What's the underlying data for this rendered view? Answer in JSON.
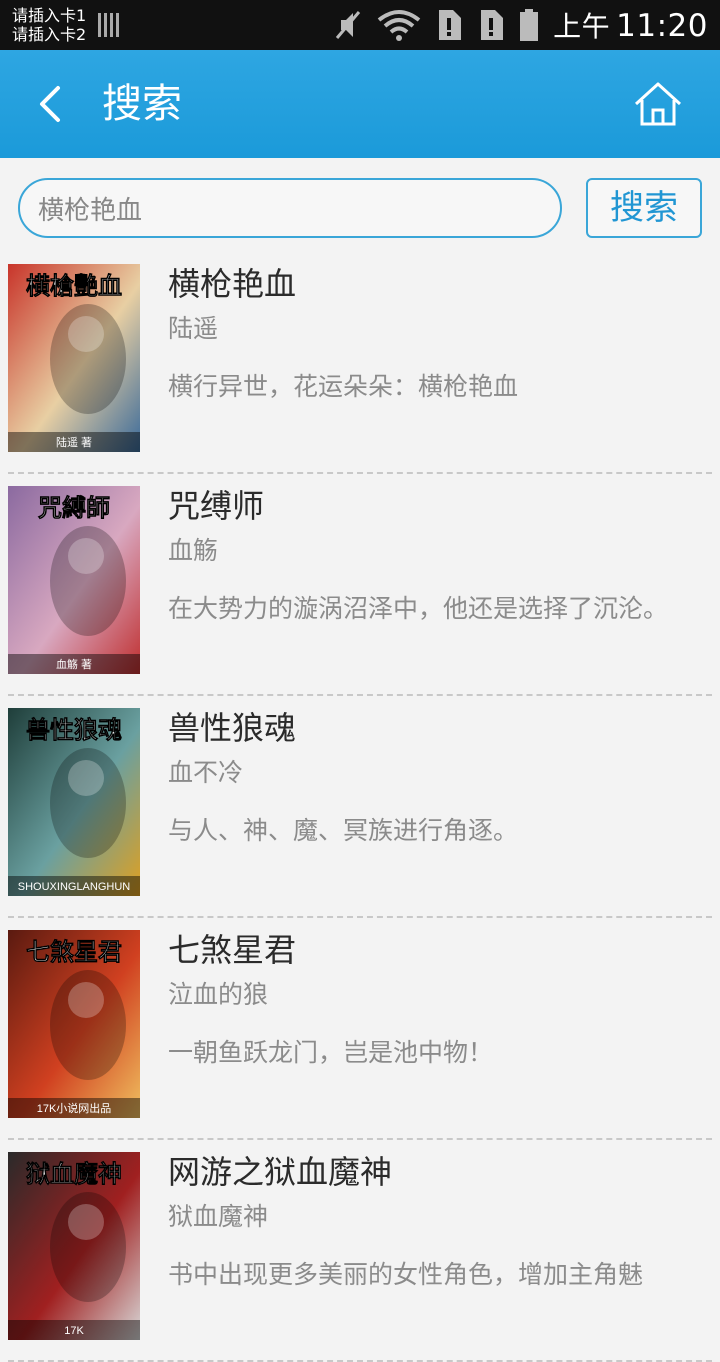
{
  "status_bar": {
    "sim1": "请插入卡1",
    "sim2": "请插入卡2",
    "time_prefix": "上午",
    "time": "11:20"
  },
  "app_bar": {
    "title": "搜索",
    "back_icon": "back-arrow-icon",
    "home_icon": "home-icon"
  },
  "search": {
    "value": "横枪艳血",
    "button_label": "搜索"
  },
  "results": [
    {
      "title": "横枪艳血",
      "author": "陆遥",
      "description": "横行异世，花运朵朵：横枪艳血",
      "cover_text": "横槍艷血",
      "cover_bottom": "陆遥 著",
      "cover_colors": [
        "#c8342a",
        "#e8cfa3",
        "#3a6a9a"
      ]
    },
    {
      "title": "咒缚师",
      "author": "血觞",
      "description": "在大势力的漩涡沼泽中，他还是选择了沉沦。",
      "cover_text": "咒縛師",
      "cover_bottom": "血觞 著",
      "cover_colors": [
        "#8b6aa0",
        "#d8a8c0",
        "#c03030"
      ]
    },
    {
      "title": "兽性狼魂",
      "author": "血不冷",
      "description": "与人、神、魔、冥族进行角逐。",
      "cover_text": "兽性狼魂",
      "cover_bottom": "SHOUXINGLANGHUN",
      "cover_colors": [
        "#1f3e3a",
        "#6aa0a0",
        "#e0a020"
      ]
    },
    {
      "title": "七煞星君",
      "author": "泣血的狼",
      "description": "一朝鱼跃龙门，岂是池中物！",
      "cover_text": "七煞星君",
      "cover_bottom": "17K小说网出品",
      "cover_colors": [
        "#5a1a10",
        "#d04020",
        "#f0c060"
      ]
    },
    {
      "title": "网游之狱血魔神",
      "author": "狱血魔神",
      "description": "书中出现更多美丽的女性角色，增加主角魅",
      "cover_text": "狱血魔神",
      "cover_bottom": "17K",
      "cover_colors": [
        "#2a2a2a",
        "#a02020",
        "#d8d8d8"
      ]
    }
  ]
}
